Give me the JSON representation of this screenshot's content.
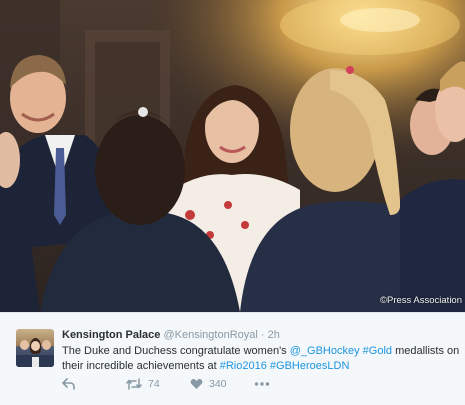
{
  "photo": {
    "credit": "©Press Association"
  },
  "tweet": {
    "author_name": "Kensington Palace",
    "author_handle": "@KensingtonRoyal",
    "separator": "·",
    "time": "2h",
    "text": {
      "part1": "The Duke and Duchess congratulate women's ",
      "mention": "@_GBHockey",
      "space1": " ",
      "hashtag_gold": "#Gold",
      "part2": " medallists on their incredible achievements at ",
      "hashtag_rio": "#Rio2016",
      "space2": " ",
      "hashtag_heroes": "#GBHeroesLDN"
    },
    "retweet_count": "74",
    "like_count": "340"
  },
  "icons": {
    "reply": "reply-icon",
    "retweet": "retweet-icon",
    "like": "heart-icon",
    "more": "more-icon"
  },
  "colors": {
    "link": "#1b95e0",
    "muted": "#8899a6",
    "text": "#292f33",
    "background": "#f5f8fa"
  }
}
